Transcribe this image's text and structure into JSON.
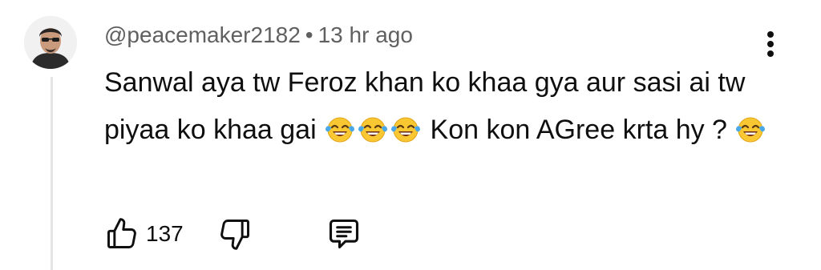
{
  "comment": {
    "username": "@peacemaker2182",
    "separator": "•",
    "time": "13 hr ago",
    "text_parts": [
      "Sanwal aya tw Feroz khan ko khaa gya aur sasi ai tw piyaa ko khaa gai ",
      " Kon kon AGree krta hy ? "
    ],
    "emoji": "face-with-tears-of-joy",
    "actions": {
      "like_count": "137"
    }
  }
}
